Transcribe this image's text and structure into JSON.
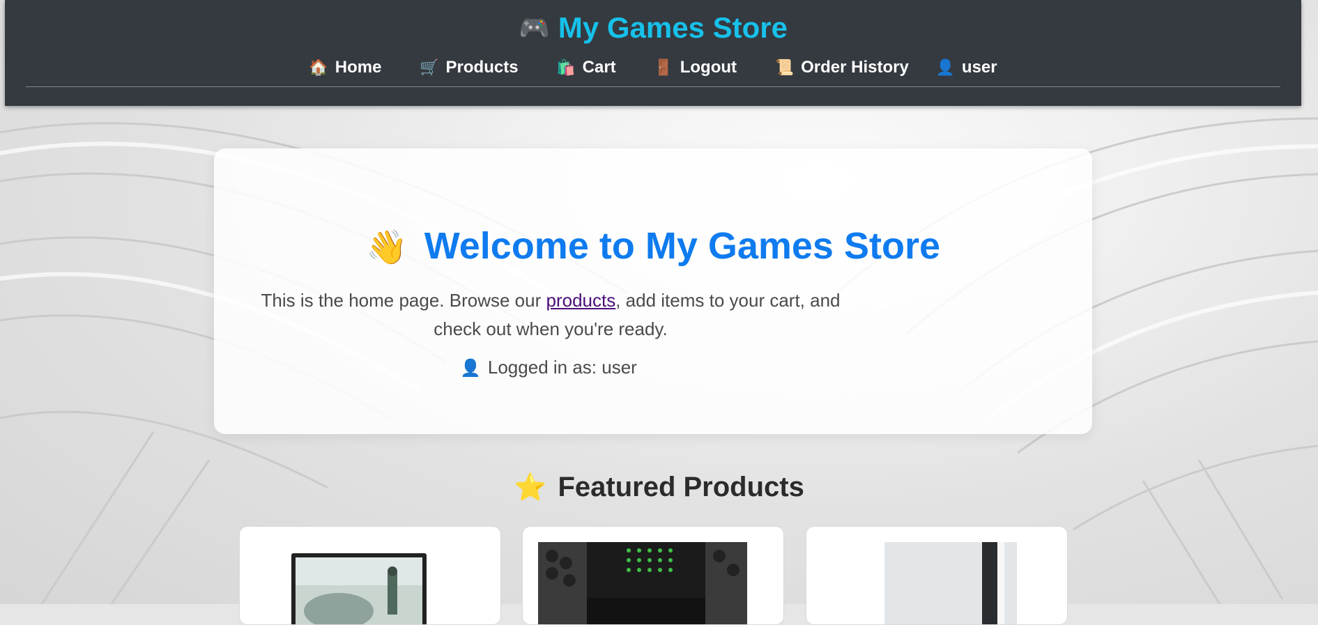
{
  "header": {
    "brand_icon": "game-controller-icon",
    "brand_title": "My Games Store",
    "nav": [
      {
        "icon": "house-icon",
        "label": "Home"
      },
      {
        "icon": "shopping-cart-icon",
        "label": "Products"
      },
      {
        "icon": "shopping-bags-icon",
        "label": "Cart"
      },
      {
        "icon": "door-icon",
        "label": "Logout"
      },
      {
        "icon": "scroll-icon",
        "label": "Order History"
      },
      {
        "icon": "user-silhouette-icon",
        "label": "user"
      }
    ]
  },
  "welcome": {
    "title_icon": "waving-hand-icon",
    "title": "Welcome to My Games Store",
    "intro_before": "This is the home page. Browse our ",
    "intro_link": "products",
    "intro_after": ", add items to your cart, and check out when you're ready.",
    "logged_in_text": "Logged in as: user"
  },
  "featured": {
    "icon": "star-icon",
    "title": "Featured Products",
    "products": [
      {
        "image": "monitor-product-image"
      },
      {
        "image": "xbox-series-x-product-image"
      },
      {
        "image": "white-console-product-image"
      }
    ]
  },
  "colors": {
    "header_bg": "#343a40",
    "brand": "#17c1ea",
    "welcome_title": "#0f7bef",
    "link": "#4b0d7a"
  }
}
